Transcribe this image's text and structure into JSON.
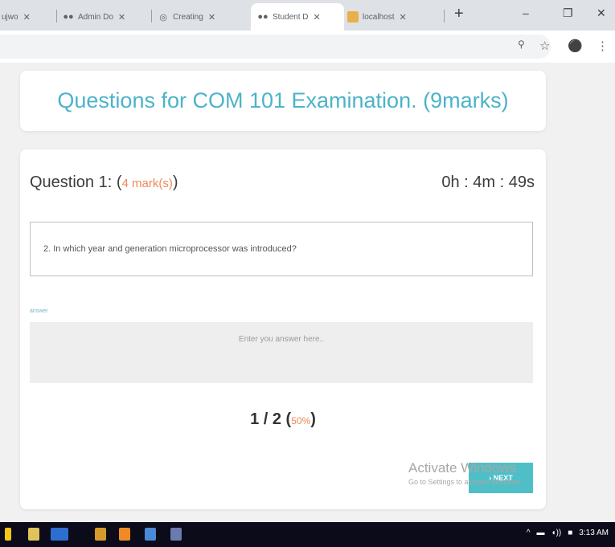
{
  "browser": {
    "tabs": [
      {
        "label": "ujwo",
        "icon": "page-icon",
        "active": false
      },
      {
        "label": "Admin Do",
        "icon": "mask-icon",
        "active": false
      },
      {
        "label": "Creating",
        "icon": "globe-icon",
        "active": false
      },
      {
        "label": "Student D",
        "icon": "mask-icon",
        "active": true
      },
      {
        "label": "localhost",
        "icon": "folder-icon",
        "active": false
      }
    ],
    "new_tab": "+",
    "window_controls": {
      "minimize": "–",
      "restore": "❐",
      "close": "✕"
    },
    "toolbar_icons": [
      "zoom-icon",
      "star-icon",
      "account-icon",
      "menu-icon"
    ]
  },
  "page": {
    "title": "Questions for COM 101 Examination. (9marks)",
    "question": {
      "label": "Question 1: (",
      "marks": "4 mark(s)",
      "close": ")",
      "timer": "0h : 4m : 49s",
      "text": "2. In which year and generation microprocessor was introduced?"
    },
    "answer": {
      "label": "answer",
      "placeholder": "Enter you answer here..",
      "value": ""
    },
    "progress": {
      "count": "1 / 2",
      "open": " (",
      "percent": "50%",
      "close": ")",
      "value": 0.5
    },
    "next_button": "NEXT",
    "watermark": {
      "line1": "Activate Windows",
      "line2": "Go to Settings to activate Windows."
    }
  },
  "taskbar": {
    "apps": [
      "windows-icon",
      "explorer-icon",
      "chrome-icon",
      "app-icon",
      "vlc-icon",
      "shield-icon",
      "calculator-icon"
    ],
    "time": "3:13 AM"
  },
  "colors": {
    "accent": "#4cb3c9",
    "highlight": "#f0875b",
    "button": "#4fbfc7"
  }
}
